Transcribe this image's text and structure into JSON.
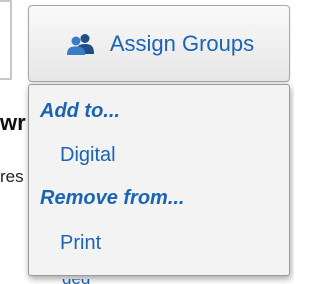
{
  "background": {
    "heading_fragment": "wr",
    "text_fragment": "res",
    "link_fragment": "ded"
  },
  "assign_button": {
    "label": "Assign Groups",
    "icon": "users-icon"
  },
  "menu": {
    "add_header": "Add to...",
    "add_items": [
      "Digital"
    ],
    "remove_header": "Remove from...",
    "remove_items": [
      "Print"
    ]
  },
  "colors": {
    "link_blue": "#1a64b4",
    "menu_background": "#f3f3f3",
    "button_border": "#a9a9a9"
  }
}
